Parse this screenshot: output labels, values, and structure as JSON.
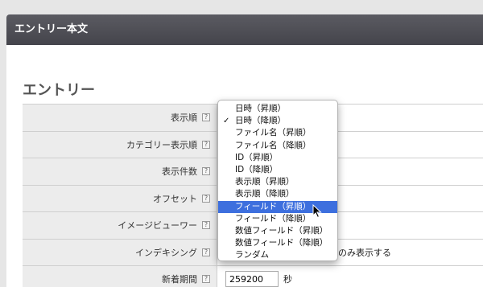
{
  "header": {
    "title": "エントリー本文"
  },
  "section": {
    "title": "エントリー"
  },
  "rows": [
    {
      "label": "表示順",
      "help": "?"
    },
    {
      "label": "カテゴリー表示順",
      "help": "?"
    },
    {
      "label": "表示件数",
      "help": "?"
    },
    {
      "label": "オフセット",
      "help": "?"
    },
    {
      "label": "イメージビューワー",
      "help": "?"
    },
    {
      "label": "インデキシング",
      "help": "?",
      "value_text": "るエントリーのみ表示する"
    },
    {
      "label": "新着期間",
      "help": "?",
      "value": "259200",
      "unit": "秒"
    }
  ],
  "dropdown": {
    "check_mark": "✓",
    "options": [
      "日時（昇順）",
      "日時（降順）",
      "ファイル名（昇順）",
      "ファイル名（降順）",
      "ID（昇順）",
      "ID（降順）",
      "表示順（昇順）",
      "表示順（降順）",
      "フィールド（昇順）",
      "フィールド（降順）",
      "数値フィールド（昇順）",
      "数値フィールド（降順）",
      "ランダム"
    ],
    "selected_index": 1,
    "highlighted_index": 8
  },
  "colors": {
    "header_bg": "#4f4f56",
    "highlight": "#3d6fde"
  }
}
